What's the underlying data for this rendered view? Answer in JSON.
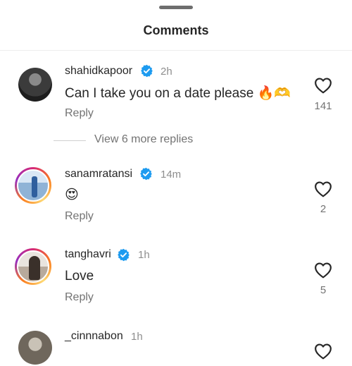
{
  "sheet": {
    "title": "Comments"
  },
  "comments": [
    {
      "username": "shahidkapoor",
      "verified": true,
      "time": "2h",
      "text": "Can I take you on a date please 🔥🫶",
      "reply_label": "Reply",
      "likes": "141"
    },
    {
      "username": "sanamratansi",
      "verified": true,
      "time": "14m",
      "text": "😍",
      "reply_label": "Reply",
      "likes": "2"
    },
    {
      "username": "tanghavri",
      "verified": true,
      "time": "1h",
      "text": "Love",
      "reply_label": "Reply",
      "likes": "5"
    },
    {
      "username": "_cinnnabon",
      "verified": false,
      "time": "1h"
    }
  ],
  "thread": {
    "view_more_label": "View 6 more replies"
  },
  "colors": {
    "verified_blue": "#1d9bf0",
    "secondary_text": "#737373",
    "story_ring": [
      "#d62976",
      "#fa7e1e",
      "#feda75",
      "#962fbf"
    ]
  },
  "icons": {
    "verified": "verified-badge-icon",
    "like": "heart-outline-icon"
  }
}
